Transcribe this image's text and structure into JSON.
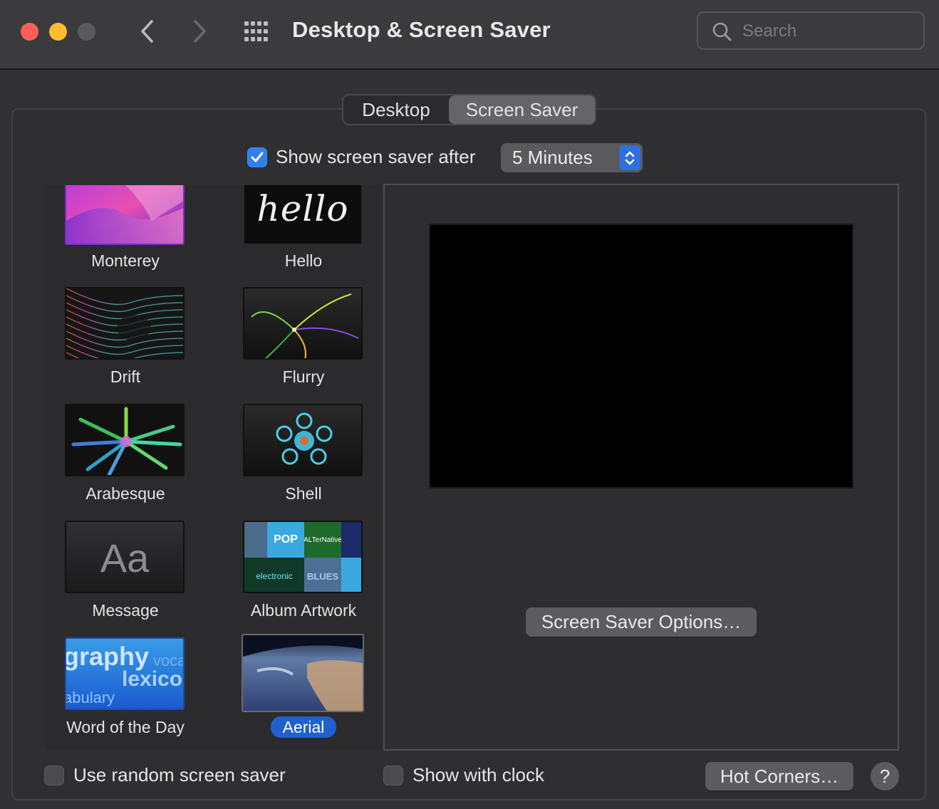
{
  "window": {
    "title": "Desktop & Screen Saver",
    "search_placeholder": "Search"
  },
  "tabs": [
    {
      "label": "Desktop",
      "selected": false
    },
    {
      "label": "Screen Saver",
      "selected": true
    }
  ],
  "show_after": {
    "label": "Show screen saver after",
    "checked": true,
    "selected_value": "5 Minutes"
  },
  "savers": [
    {
      "name": "Monterey"
    },
    {
      "name": "Hello"
    },
    {
      "name": "Drift"
    },
    {
      "name": "Flurry"
    },
    {
      "name": "Arabesque"
    },
    {
      "name": "Shell"
    },
    {
      "name": "Message"
    },
    {
      "name": "Album Artwork"
    },
    {
      "name": "Word of the Day"
    },
    {
      "name": "Aerial",
      "selected": true
    }
  ],
  "thumb_text": {
    "hello": "hello",
    "message": "Aa",
    "word_1": "graphy",
    "word_2": "voca",
    "word_3": "lexicog",
    "word_4": "abulary",
    "album_pop": "POP",
    "album_alt": "ALTerNative",
    "album_elec": "electronic",
    "album_blues": "BLUES"
  },
  "buttons": {
    "options": "Screen Saver Options…",
    "hot_corners": "Hot Corners…",
    "help": "?"
  },
  "footer": {
    "random_label": "Use random screen saver",
    "random_checked": false,
    "clock_label": "Show with clock",
    "clock_checked": false
  },
  "colors": {
    "accent": "#2f80ed",
    "selection": "#1f5fce",
    "close": "#ff5f57",
    "minimize": "#febc2e"
  }
}
